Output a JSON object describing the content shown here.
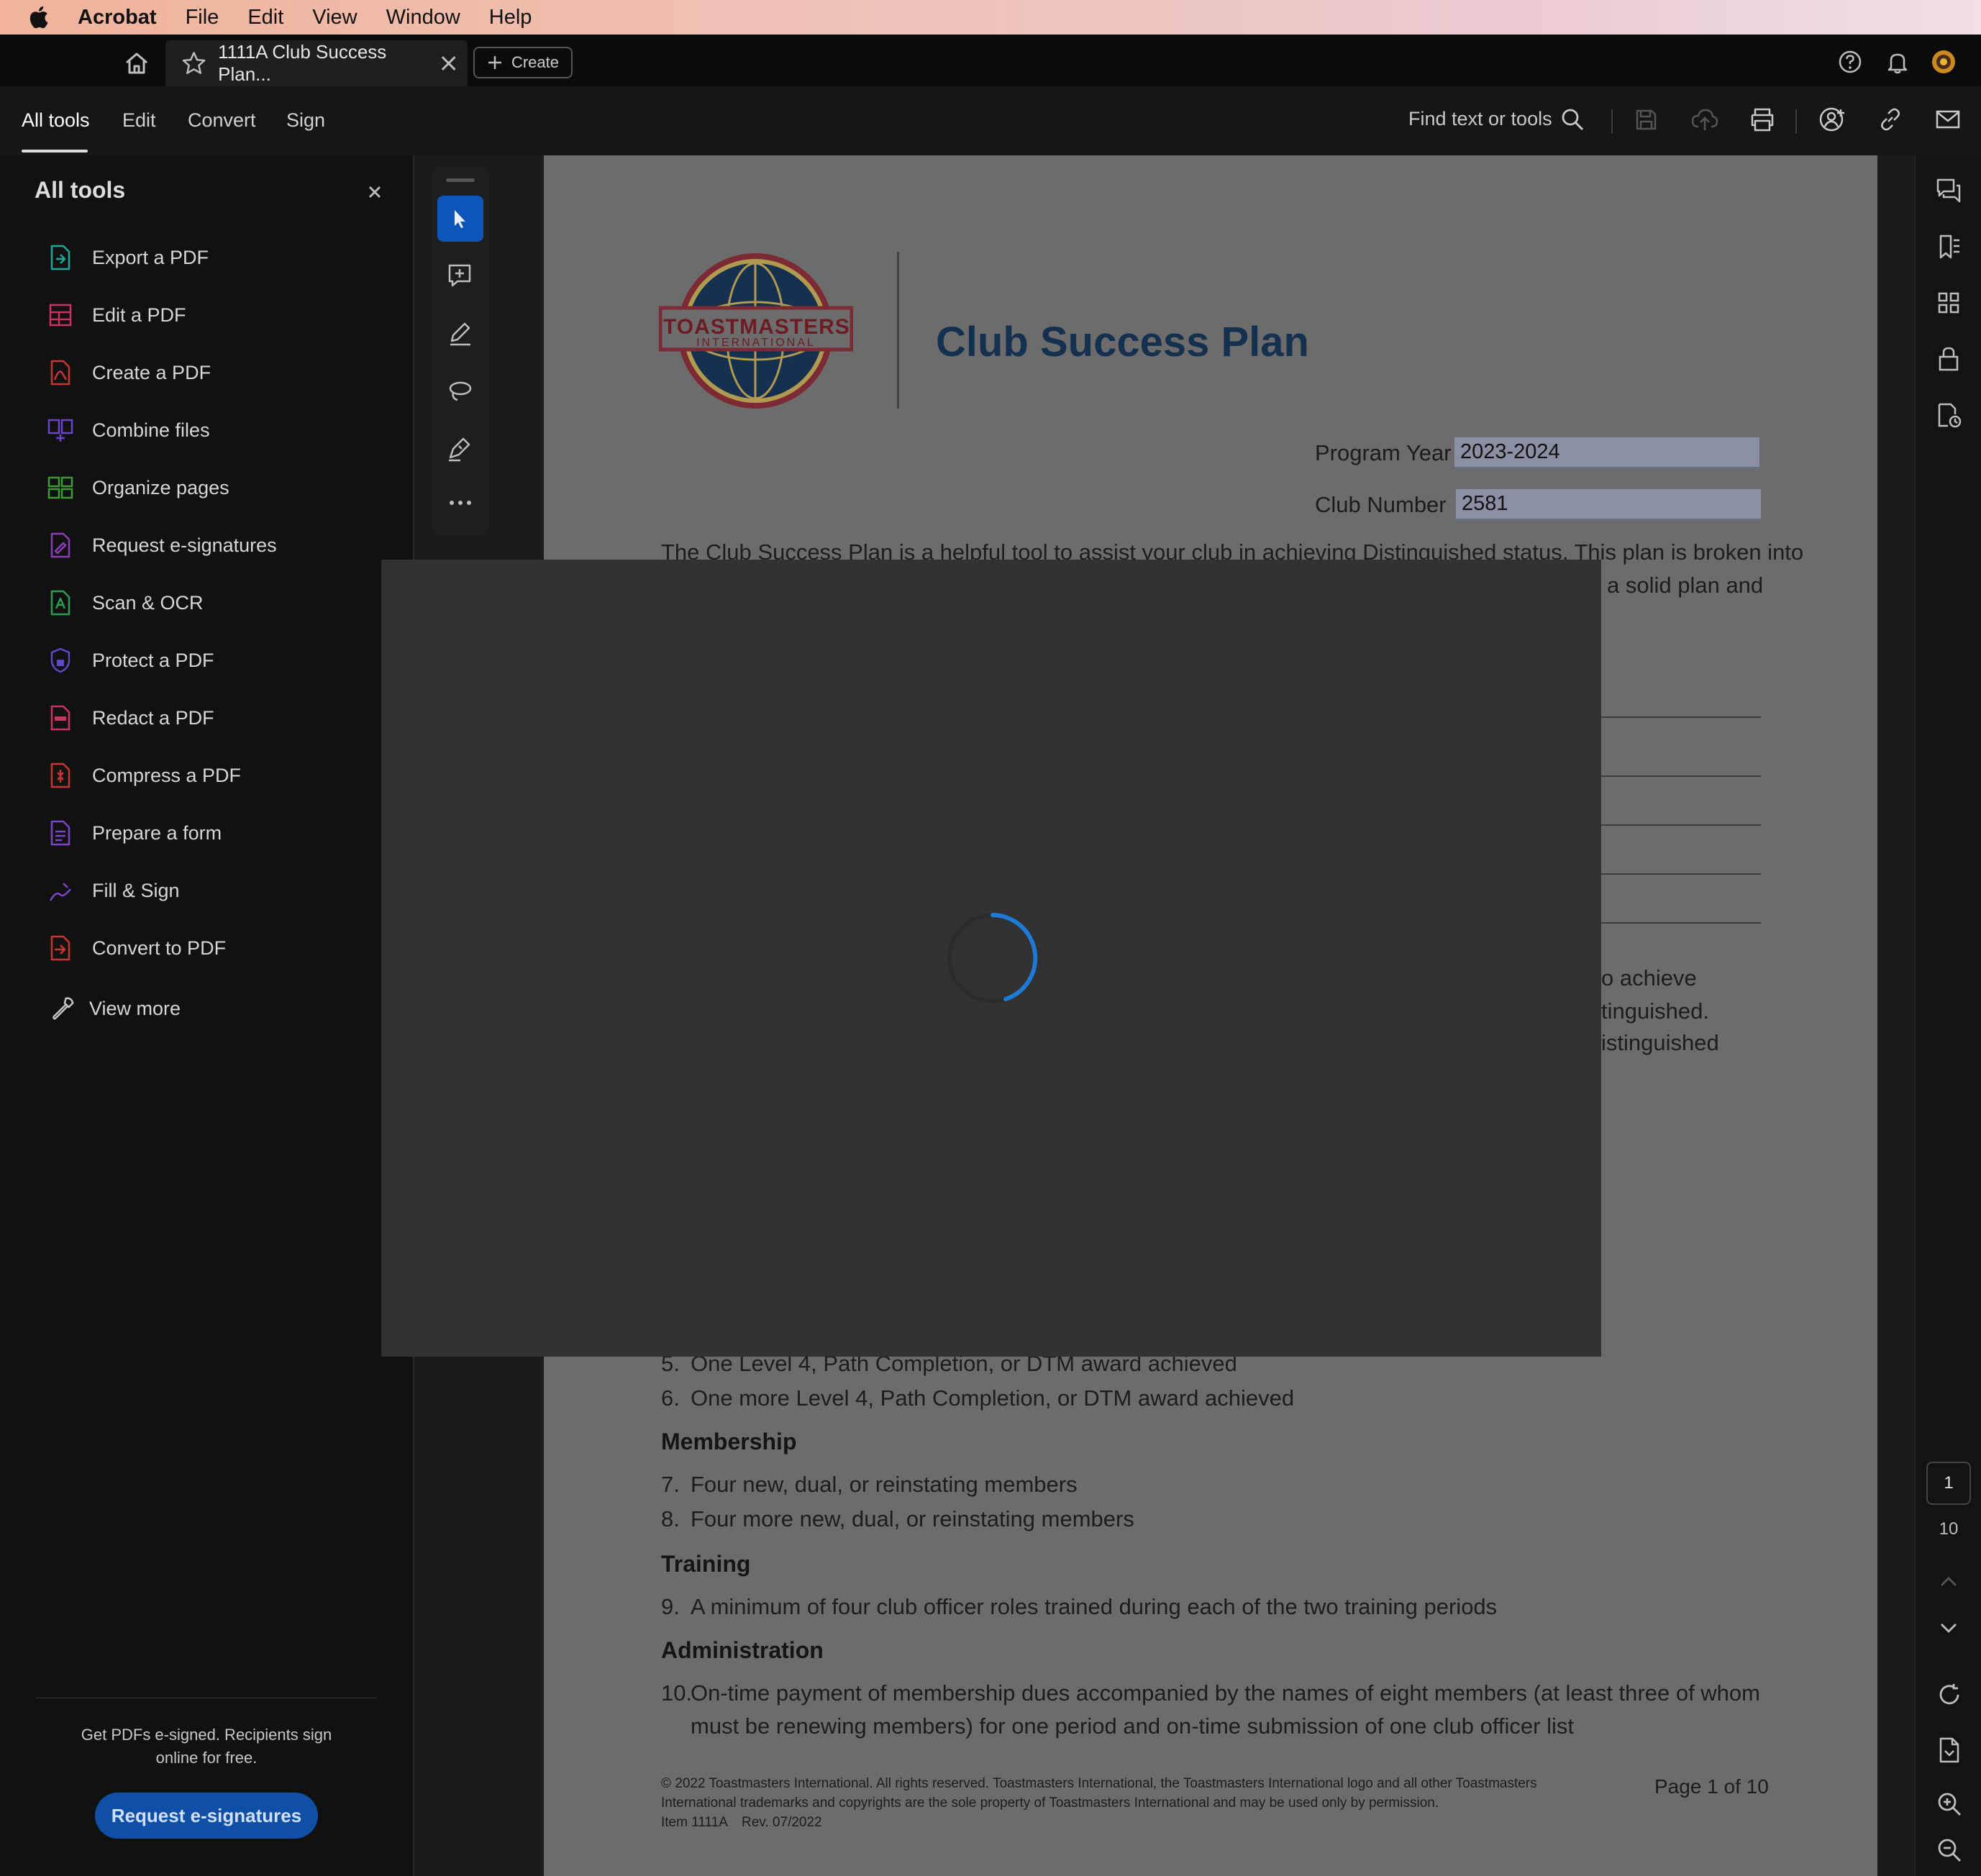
{
  "menubar": {
    "app": "Acrobat",
    "items": [
      "File",
      "Edit",
      "View",
      "Window",
      "Help"
    ]
  },
  "tabbar": {
    "tab_title": "1111A Club Success Plan...",
    "create_label": "Create"
  },
  "toolbar": {
    "nav": [
      "All tools",
      "Edit",
      "Convert",
      "Sign"
    ],
    "search_placeholder": "Find text or tools"
  },
  "left_panel": {
    "title": "All tools",
    "items": [
      {
        "label": "Export a PDF",
        "icon": "export-pdf-icon",
        "color": "#1fa79a"
      },
      {
        "label": "Edit a PDF",
        "icon": "edit-pdf-icon",
        "color": "#c8335f"
      },
      {
        "label": "Create a PDF",
        "icon": "create-pdf-icon",
        "color": "#c83535"
      },
      {
        "label": "Combine files",
        "icon": "combine-files-icon",
        "color": "#6b45c8"
      },
      {
        "label": "Organize pages",
        "icon": "organize-pages-icon",
        "color": "#3f9a3a"
      },
      {
        "label": "Request e-signatures",
        "icon": "request-esign-icon",
        "color": "#8a3fb8"
      },
      {
        "label": "Scan & OCR",
        "icon": "scan-ocr-icon",
        "color": "#2f9a52"
      },
      {
        "label": "Protect a PDF",
        "icon": "protect-pdf-icon",
        "color": "#5a4ac8"
      },
      {
        "label": "Redact a PDF",
        "icon": "redact-pdf-icon",
        "color": "#c8335f"
      },
      {
        "label": "Compress a PDF",
        "icon": "compress-pdf-icon",
        "color": "#c83535"
      },
      {
        "label": "Prepare a form",
        "icon": "prepare-form-icon",
        "color": "#7c45c8"
      },
      {
        "label": "Fill & Sign",
        "icon": "fill-sign-icon",
        "color": "#7c45c8"
      },
      {
        "label": "Convert to PDF",
        "icon": "convert-to-pdf-icon",
        "color": "#c83535"
      }
    ],
    "view_more": "View more",
    "promo_text": "Get PDFs e-signed. Recipients sign online for free.",
    "promo_button": "Request e-signatures"
  },
  "document": {
    "logo_line1": "TOASTMASTERS",
    "logo_line2": "INTERNATIONAL",
    "title": "Club Success Plan",
    "program_year_label": "Program Year",
    "program_year_value": "2023-2024",
    "club_number_label": "Club Number",
    "club_number_value": "2581",
    "intro_line1": "The Club Success Plan is a helpful tool to assist your club in achieving Distinguished status. This plan is broken into",
    "intro_line2_fragment": "a solid plan and",
    "mid_fragments": [
      "o achieve",
      "tinguished.",
      "istinguished"
    ],
    "education_items": [
      {
        "num": "5.",
        "text": "One Level 4, Path Completion, or DTM award achieved"
      },
      {
        "num": "6.",
        "text": "One more Level 4, Path Completion, or DTM award achieved"
      }
    ],
    "membership_heading": "Membership",
    "membership_items": [
      {
        "num": "7.",
        "text": "Four new, dual, or reinstating members"
      },
      {
        "num": "8.",
        "text": "Four more new, dual, or reinstating members"
      }
    ],
    "training_heading": "Training",
    "training_items": [
      {
        "num": "9.",
        "text": "A minimum of four club officer roles trained during each of the two training periods"
      }
    ],
    "administration_heading": "Administration",
    "administration_items": [
      {
        "num": "10.",
        "line1": "On-time payment of membership dues accompanied by the names of eight members (at least three of whom",
        "line2": "must be renewing members) for one period and on-time submission of one club officer list"
      }
    ],
    "footer_line1": "© 2022 Toastmasters International. All rights reserved. Toastmasters International, the Toastmasters International logo and all other Toastmasters",
    "footer_line2": "International trademarks and copyrights are the sole property of Toastmasters International and may be used only by permission.",
    "footer_item": "Item 1111A",
    "footer_rev": "Rev. 07/2022",
    "page_label": "Page 1 of 10"
  },
  "right_rail": {
    "current_page": "1",
    "total_pages": "10"
  },
  "colors": {
    "accent": "#0f4fa8",
    "spinner": "#1f7ad6",
    "title_navy": "#15314f"
  }
}
